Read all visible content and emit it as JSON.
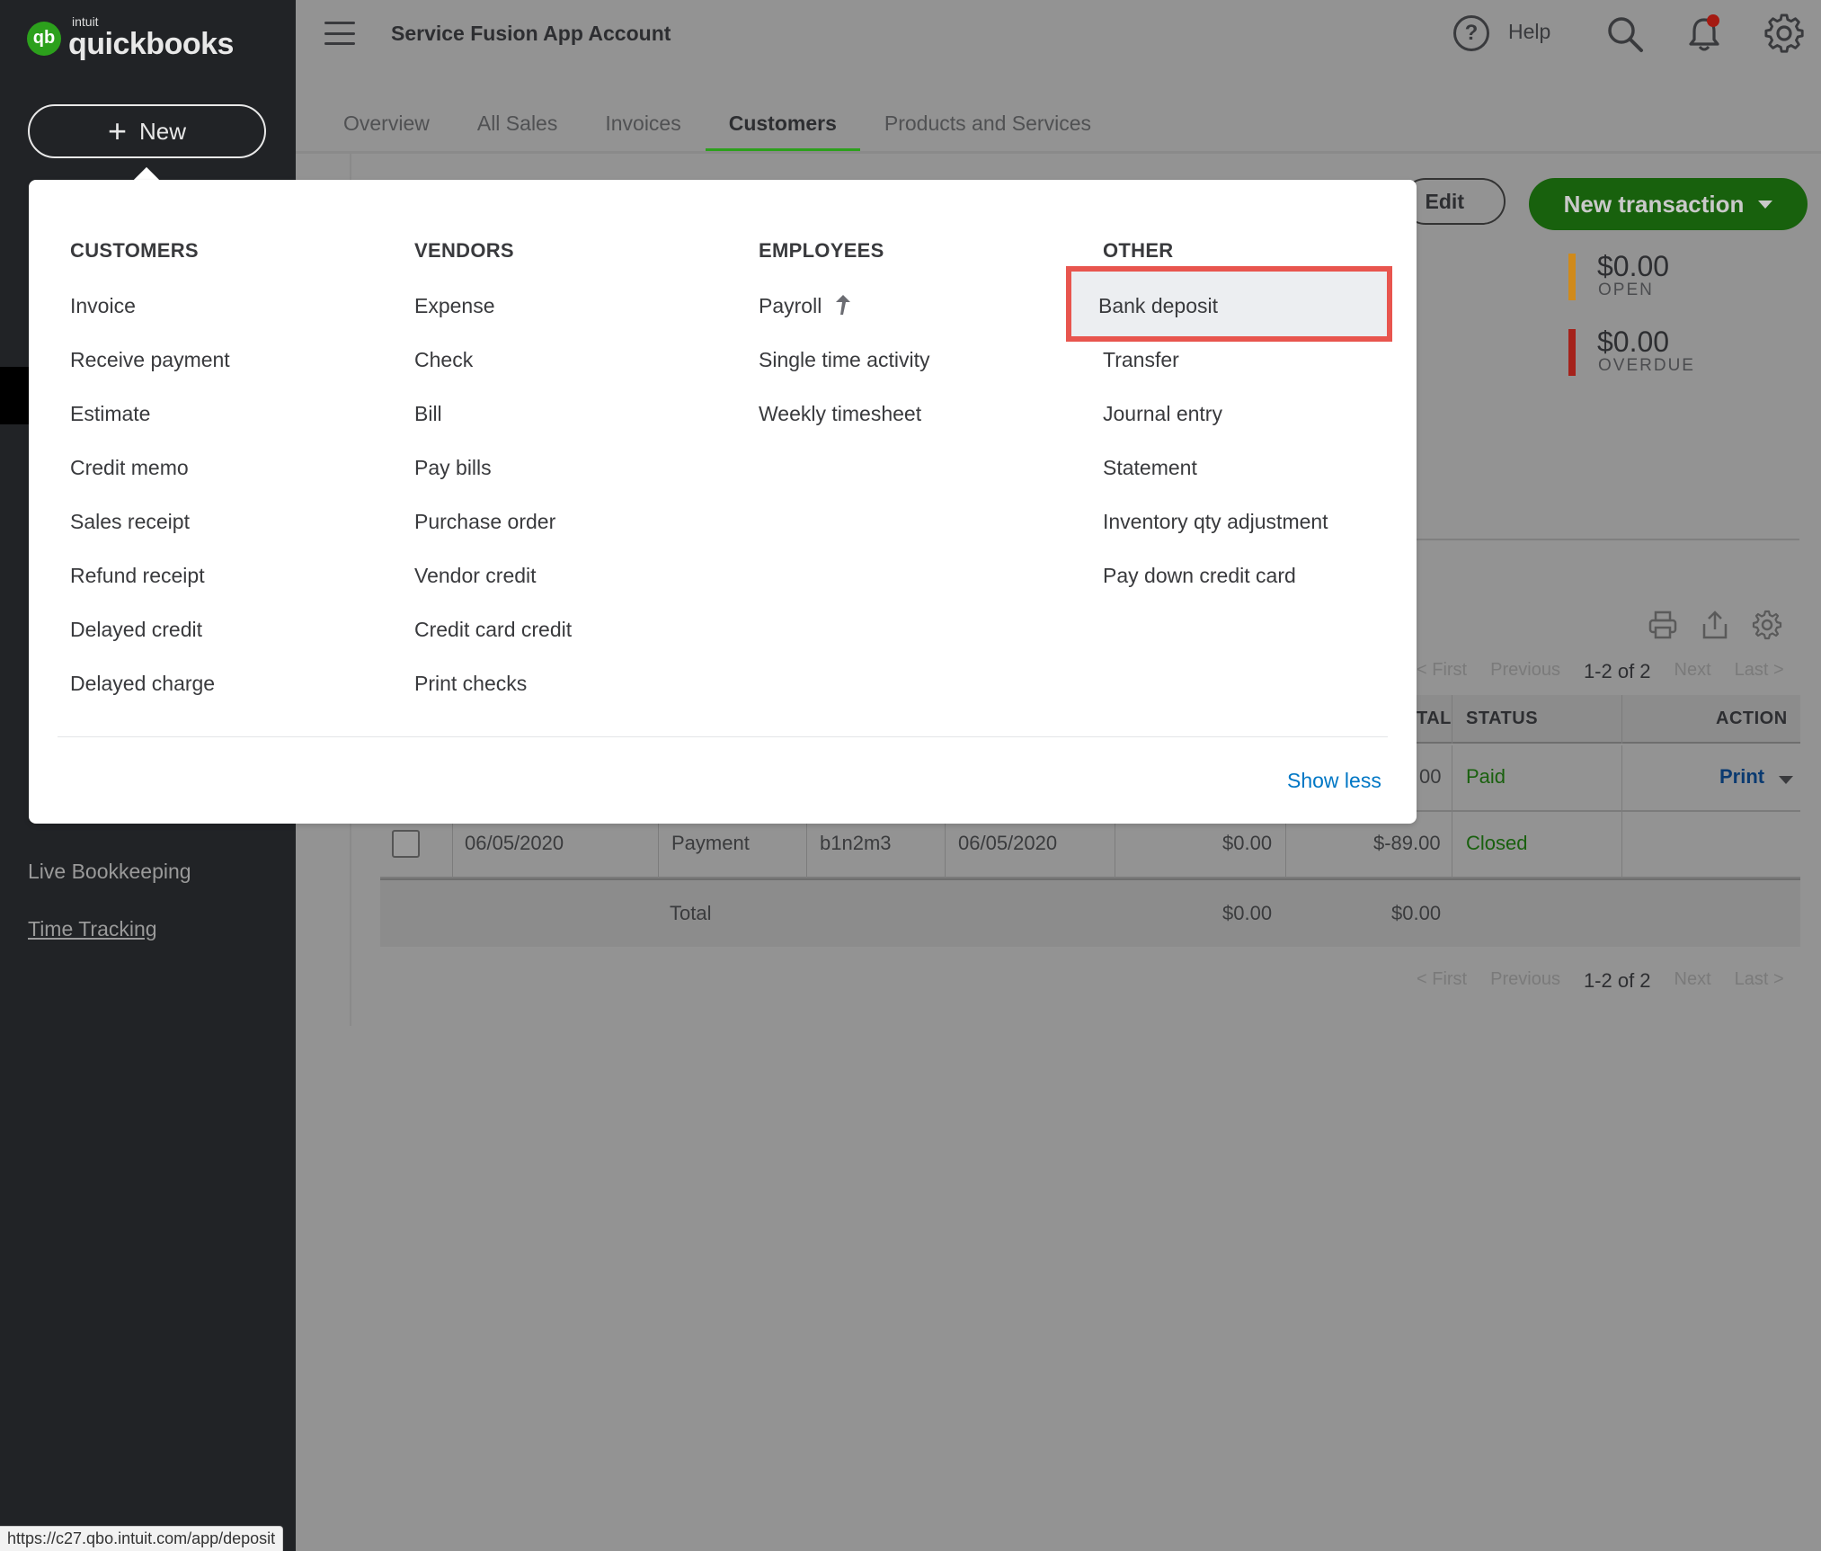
{
  "app": {
    "logo_small": "intuit",
    "logo_name": "quickbooks",
    "company_name": "Service Fusion App Account",
    "help_label": "Help",
    "new_button_label": "New"
  },
  "sidebar": {
    "links": [
      "Live Bookkeeping",
      "Time Tracking"
    ]
  },
  "tabs": [
    {
      "label": "Overview",
      "active": false
    },
    {
      "label": "All Sales",
      "active": false
    },
    {
      "label": "Invoices",
      "active": false
    },
    {
      "label": "Customers",
      "active": true
    },
    {
      "label": "Products and Services",
      "active": false
    }
  ],
  "page": {
    "edit_label": "Edit",
    "new_transaction_label": "New transaction",
    "metrics": [
      {
        "amount": "$0.00",
        "label": "OPEN",
        "color": "#d08a1b"
      },
      {
        "amount": "$0.00",
        "label": "OVERDUE",
        "color": "#c0281f"
      }
    ],
    "pager": {
      "first": "< First",
      "previous": "Previous",
      "count": "1-2 of 2",
      "next": "Next",
      "last": "Last >"
    },
    "table": {
      "headers": {
        "total_partial": "TAL",
        "status": "STATUS",
        "action": "ACTION"
      },
      "row1": {
        "total_partial": "00",
        "status": "Paid",
        "action": "Print"
      },
      "row2": {
        "date": "06/05/2020",
        "type": "Payment",
        "no": "b1n2m3",
        "due": "06/05/2020",
        "balance": "$0.00",
        "total": "$-89.00",
        "status": "Closed"
      },
      "total_row": {
        "label": "Total",
        "balance": "$0.00",
        "total": "$0.00"
      }
    }
  },
  "dropdown": {
    "columns": [
      {
        "title": "CUSTOMERS",
        "items": [
          "Invoice",
          "Receive payment",
          "Estimate",
          "Credit memo",
          "Sales receipt",
          "Refund receipt",
          "Delayed credit",
          "Delayed charge"
        ]
      },
      {
        "title": "VENDORS",
        "items": [
          "Expense",
          "Check",
          "Bill",
          "Pay bills",
          "Purchase order",
          "Vendor credit",
          "Credit card credit",
          "Print checks"
        ]
      },
      {
        "title": "EMPLOYEES",
        "items": [
          "Payroll",
          "Single time activity",
          "Weekly timesheet"
        ]
      },
      {
        "title": "OTHER",
        "items": [
          "Bank deposit",
          "Transfer",
          "Journal entry",
          "Statement",
          "Inventory qty adjustment",
          "Pay down credit card"
        ]
      }
    ],
    "show_less": "Show less"
  },
  "status_url": "https://c27.qbo.intuit.com/app/deposit",
  "colors": {
    "brand_green": "#2ca01c",
    "link_blue": "#0077c5",
    "highlight_red": "#e8554e"
  }
}
